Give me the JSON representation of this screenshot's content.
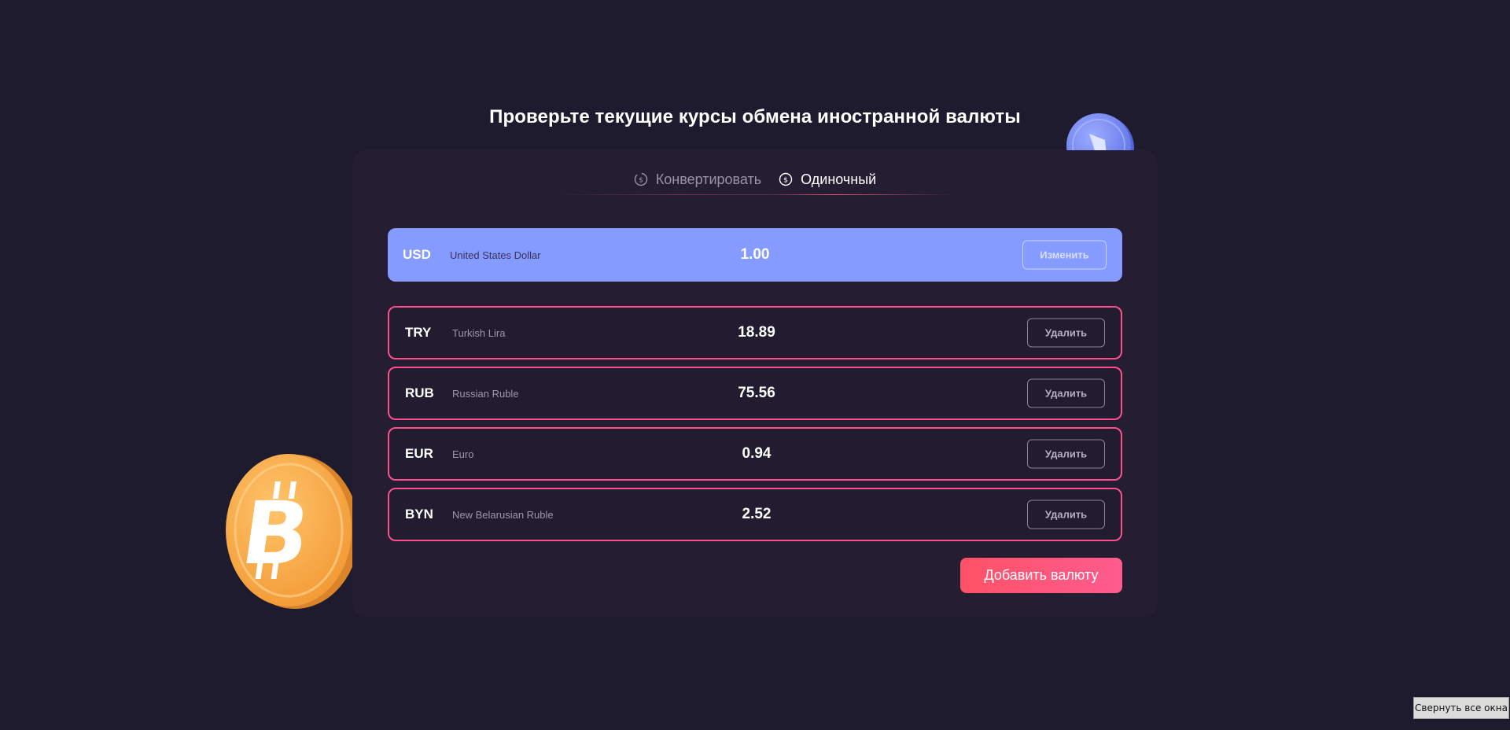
{
  "page": {
    "title": "Проверьте текущие курсы обмена иностранной валюты"
  },
  "tabs": [
    {
      "label": "Конвертировать",
      "icon": "refresh-coin-icon",
      "active": false
    },
    {
      "label": "Одиночный",
      "icon": "dollar-coin-icon",
      "active": true
    }
  ],
  "base_currency": {
    "code": "USD",
    "name": "United States Dollar",
    "rate": "1.00",
    "action_label": "Изменить"
  },
  "currencies": [
    {
      "code": "TRY",
      "name": "Turkish Lira",
      "rate": "18.89",
      "action_label": "Удалить"
    },
    {
      "code": "RUB",
      "name": "Russian Ruble",
      "rate": "75.56",
      "action_label": "Удалить"
    },
    {
      "code": "EUR",
      "name": "Euro",
      "rate": "0.94",
      "action_label": "Удалить"
    },
    {
      "code": "BYN",
      "name": "New Belarusian Ruble",
      "rate": "2.52",
      "action_label": "Удалить"
    }
  ],
  "add_button_label": "Добавить валюту",
  "taskbar_tooltip": "Свернуть все окна",
  "decor": {
    "eth_coin_icon": "ethereum-coin-icon",
    "btc_coin_icon": "bitcoin-coin-icon"
  },
  "colors": {
    "background": "#1f1b2e",
    "panel": "#251e33",
    "accent_pink": "#ff4f8f",
    "base_row": "#869bff",
    "add_button": "#ff5267"
  }
}
